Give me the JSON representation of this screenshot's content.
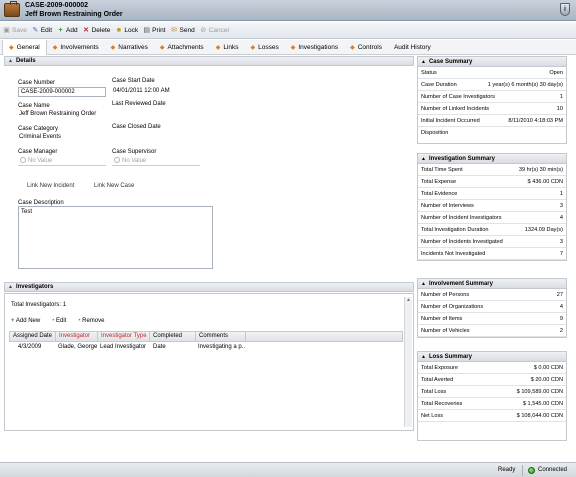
{
  "window": {
    "case_id": "CASE-2009-000002",
    "case_title": "Jeff Brown Restraining Order"
  },
  "toolbar": {
    "save": "Save",
    "edit": "Edit",
    "add": "Add",
    "delete": "Delete",
    "lock": "Lock",
    "print": "Print",
    "send": "Send",
    "cancel": "Cancel"
  },
  "tabs": [
    "General",
    "Involvements",
    "Narratives",
    "Attachments",
    "Links",
    "Losses",
    "Investigations",
    "Controls",
    "Audit History"
  ],
  "details": {
    "header": "Details",
    "case_number_label": "Case Number",
    "case_number": "CASE-2009-000002",
    "case_start_date_label": "Case Start Date",
    "case_start_date": "04/01/2011 12:00 AM",
    "case_name_label": "Case Name",
    "case_name": "Jeff Brown Restraining Order",
    "last_reviewed_label": "Last Reviewed Date",
    "case_category_label": "Case Category",
    "case_category": "Criminal Events",
    "case_closed_label": "Case Closed Date",
    "case_manager_label": "Case Manager",
    "case_manager_placeholder": "No Value",
    "case_supervisor_label": "Case Supervisor",
    "case_supervisor_placeholder": "No Value",
    "link_incident": "Link New Incident",
    "link_case": "Link New Case",
    "description_label": "Case Description",
    "description": "Test"
  },
  "investigators": {
    "header": "Investigators",
    "total": "Total Investigators: 1",
    "add_new": "Add New",
    "edit": "Edit",
    "remove": "Remove",
    "columns": [
      "Assigned Date",
      "Investigator",
      "Investigator Type",
      "Completed Date",
      "Comments"
    ],
    "rows": [
      {
        "assigned": "4/3/2009",
        "investigator": "Glade, George",
        "type": "Lead Investigator",
        "completed": "",
        "comments": "Investigating a p..."
      }
    ]
  },
  "case_summary": {
    "header": "Case Summary",
    "rows": [
      {
        "k": "Status",
        "v": "Open"
      },
      {
        "k": "Case Duration",
        "v": "1 year(s) 6 month(s) 30 day(s)"
      },
      {
        "k": "Number of Case Investigators",
        "v": "1"
      },
      {
        "k": "Number of Linked Incidents",
        "v": "10"
      },
      {
        "k": "Initial Incident Occurred",
        "v": "8/11/2010 4:18:03 PM"
      },
      {
        "k": "Disposition",
        "v": ""
      }
    ]
  },
  "investigation_summary": {
    "header": "Investigation Summary",
    "rows": [
      {
        "k": "Total Time Spent",
        "v": "39 hr(s) 30 min(s)"
      },
      {
        "k": "Total Expense",
        "v": "$  436.00 CDN"
      },
      {
        "k": "Total Evidence",
        "v": "1"
      },
      {
        "k": "Number of Interviews",
        "v": "3"
      },
      {
        "k": "Number of Incident Investigators",
        "v": "4"
      },
      {
        "k": "Total Investigation Duration",
        "v": "1324.09 Day(s)"
      },
      {
        "k": "Number of Incidents Investigated",
        "v": "3"
      },
      {
        "k": "Incidents Not Investigated",
        "v": "7"
      }
    ]
  },
  "involvement_summary": {
    "header": "Involvement Summary",
    "rows": [
      {
        "k": "Number of Persons",
        "v": "27"
      },
      {
        "k": "Number of Organizations",
        "v": "4"
      },
      {
        "k": "Number of Items",
        "v": "9"
      },
      {
        "k": "Number of Vehicles",
        "v": "2"
      }
    ]
  },
  "loss_summary": {
    "header": "Loss Summary",
    "rows": [
      {
        "k": "Total Exposure",
        "v": "$      0.00 CDN"
      },
      {
        "k": "Total Averted",
        "v": "$    20.00 CDN"
      },
      {
        "k": "Total Loss",
        "v": "$  109,589.00 CDN"
      },
      {
        "k": "Total Recoveries",
        "v": "$    1,545.00 CDN"
      },
      {
        "k": "Net Loss",
        "v": "$  108,044.00 CDN"
      }
    ]
  },
  "status": {
    "ready": "Ready",
    "connected": "Connected"
  }
}
